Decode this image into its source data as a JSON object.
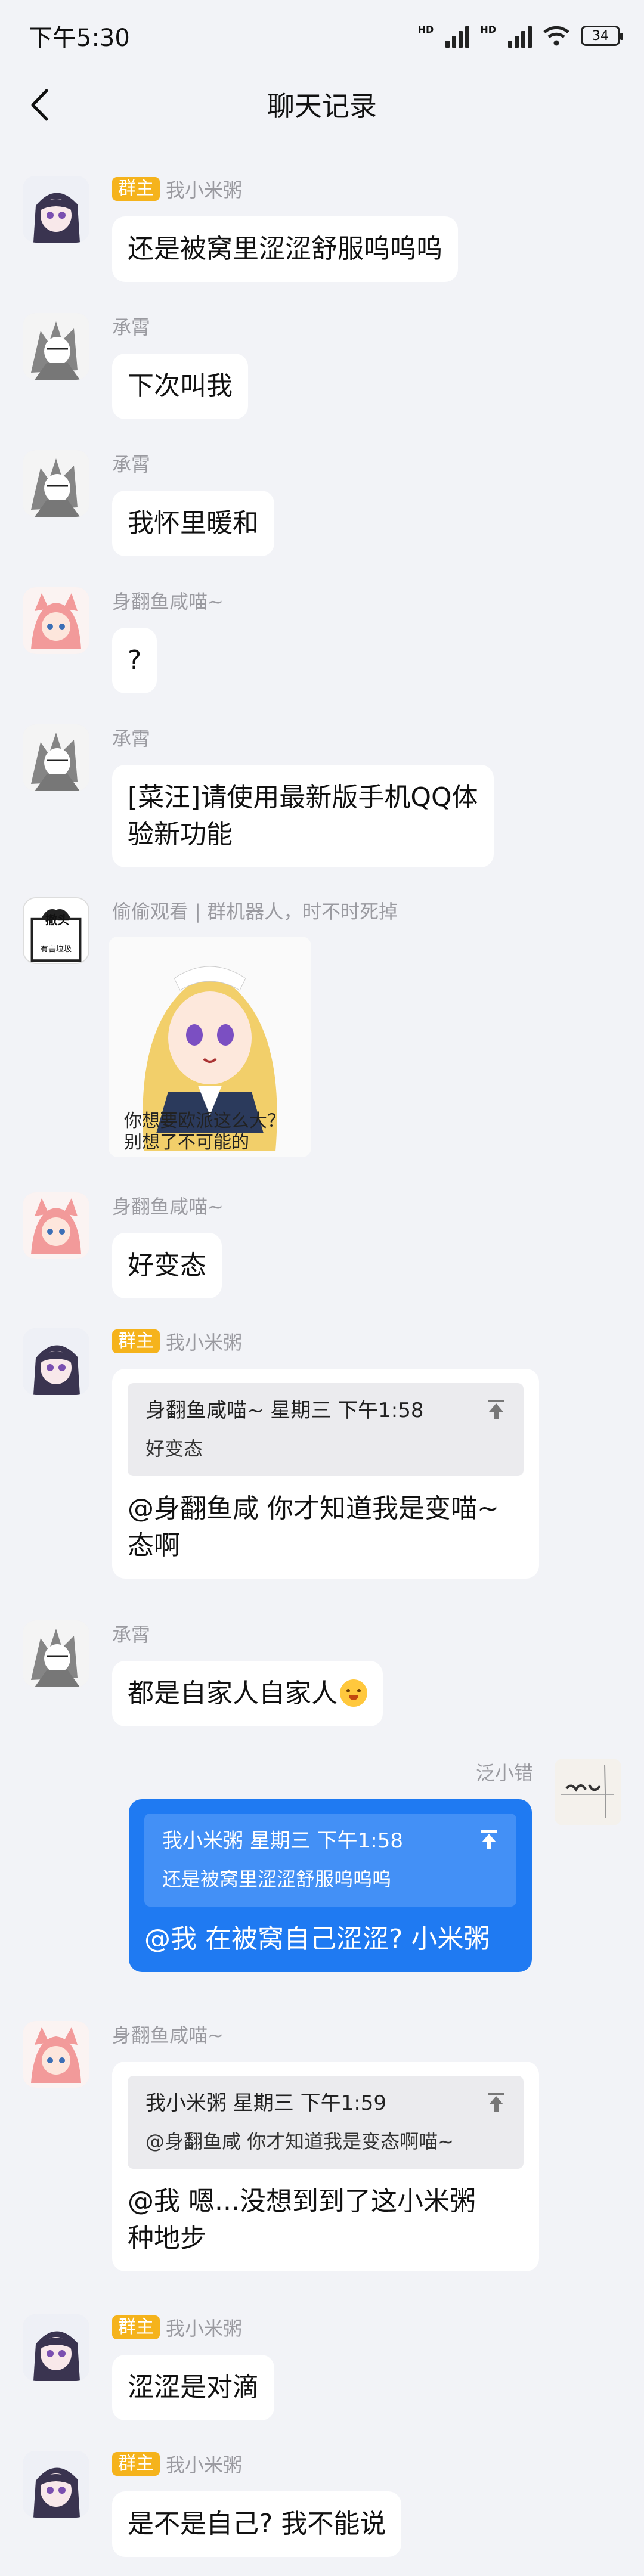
{
  "status": {
    "time": "下午5:30",
    "hd1": "HD",
    "hd2": "HD",
    "battery": "34"
  },
  "header": {
    "title": "聊天记录"
  },
  "messages": [
    {
      "badge": "群主",
      "name": "我小米粥",
      "text": "还是被窝里涩涩舒服呜呜呜"
    },
    {
      "name": "承霄",
      "text": "下次叫我"
    },
    {
      "name": "承霄",
      "text": "我怀里暖和"
    },
    {
      "name": "身翻鱼咸喵~",
      "text": "?"
    },
    {
      "name": "承霄",
      "line1": "[菜汪]请使用最新版手机QQ体",
      "line2": "验新功能"
    },
    {
      "name": "偷偷观看 | 群机器人，时不时死掉",
      "sticker_line1": "你想要欧派这么大？",
      "sticker_line2": "别想了不可能的",
      "avatar_text1": "撤头",
      "avatar_text2": "有害垃圾"
    },
    {
      "name": "身翻鱼咸喵~",
      "text": "好变态"
    },
    {
      "badge": "群主",
      "name": "我小米粥",
      "quote_head": "身翻鱼咸喵~ 星期三 下午1:58",
      "quote_body": "好变态",
      "line1": "@身翻鱼咸 你才知道我是变喵~",
      "line2": "态啊"
    },
    {
      "name": "承霄",
      "text": "都是自家人自家人"
    },
    {
      "name": "泛小错",
      "quote_head": "我小米粥  星期三 下午1:58",
      "quote_body": "还是被窝里涩涩舒服呜呜呜",
      "text": "@我 在被窝自己涩涩? 小米粥"
    },
    {
      "name": "身翻鱼咸喵~",
      "quote_head": "我小米粥  星期三 下午1:59",
      "quote_body": "@身翻鱼咸 你才知道我是变态啊喵~",
      "line1": "@我 嗯...没想到到了这小米粥",
      "line2": "种地步"
    },
    {
      "badge": "群主",
      "name": "我小米粥",
      "text": "涩涩是对滴"
    },
    {
      "badge": "群主",
      "name": "我小米粥",
      "text": "是不是自己? 我不能说"
    }
  ]
}
